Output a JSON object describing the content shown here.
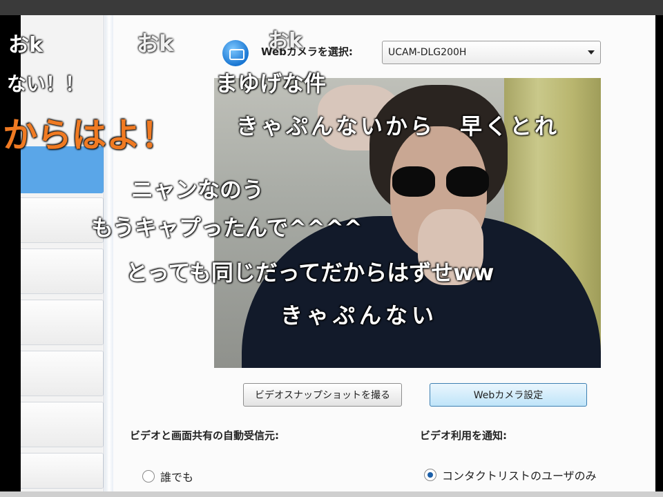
{
  "window": {
    "chrome_color": "#3a3a3a",
    "background_color": "#fbfbfb"
  },
  "header": {
    "logo_icon": "webcam-logo-icon",
    "select_label": "Webカメラを選択:",
    "camera_select_value": "UCAM-DLG200H"
  },
  "sidebar": {
    "selected_color": "#5aa6e8",
    "items": [
      {
        "state": "selected"
      },
      {
        "state": "normal"
      },
      {
        "state": "normal"
      },
      {
        "state": "normal"
      },
      {
        "state": "normal"
      },
      {
        "state": "normal"
      },
      {
        "state": "normal"
      }
    ]
  },
  "preview": {
    "description_icon": "webcam-video-feed"
  },
  "buttons": {
    "snapshot_label": "ビデオスナップショットを撮る",
    "settings_label": "Webカメラ設定"
  },
  "auto_receive": {
    "label": "ビデオと画面共有の自動受信元:",
    "option_anyone": "誰でも"
  },
  "notify": {
    "label": "ビデオ利用を通知:",
    "option_contacts": "コンタクトリストのユーザのみ"
  },
  "overlay_comments": [
    {
      "text": "おk"
    },
    {
      "text": "おk"
    },
    {
      "text": "おk"
    },
    {
      "text": "ない！！"
    },
    {
      "text": "からはよ！"
    },
    {
      "text": "まゆげな件"
    },
    {
      "text": "きゃぷんないから　早くとれ"
    },
    {
      "text": "ニャンなのう"
    },
    {
      "text": "もうキャプったんで^^^^"
    },
    {
      "text": "とっても同じだってだからはずせww"
    },
    {
      "text": "きゃぷんない"
    }
  ],
  "accent_colors": {
    "orange_comment": "#f07a22",
    "primary_button": "#bfe4f9"
  }
}
